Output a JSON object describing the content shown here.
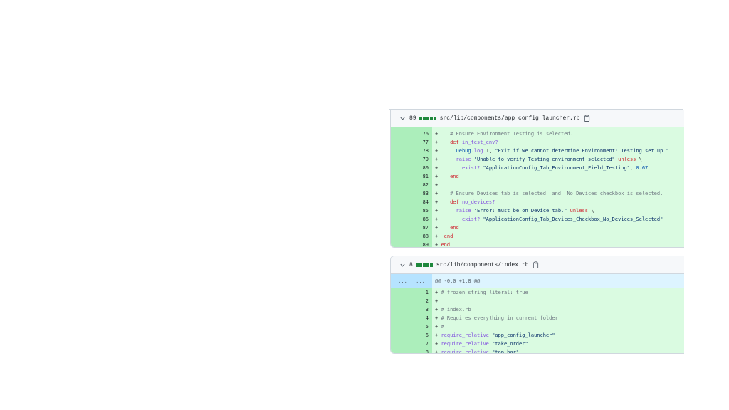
{
  "files": [
    {
      "count": "89",
      "path": "src/lib/components/app_config_launcher.rb",
      "lines": [
        {
          "num": "76",
          "tokens": [
            {
              "t": "+    ",
              "c": ""
            },
            {
              "t": "# Ensure Environment Testing is selected.",
              "c": "cm"
            }
          ]
        },
        {
          "num": "77",
          "tokens": [
            {
              "t": "+    ",
              "c": ""
            },
            {
              "t": "def ",
              "c": "kw"
            },
            {
              "t": "in_test_env?",
              "c": "fn"
            }
          ]
        },
        {
          "num": "78",
          "tokens": [
            {
              "t": "+      ",
              "c": ""
            },
            {
              "t": "Debug",
              "c": "nm"
            },
            {
              "t": ".",
              "c": ""
            },
            {
              "t": "log",
              "c": "fn"
            },
            {
              "t": " 1, ",
              "c": ""
            },
            {
              "t": "\"Exit if we cannot determine Environment: Testing set up.\"",
              "c": "st"
            }
          ]
        },
        {
          "num": "79",
          "tokens": [
            {
              "t": "+      ",
              "c": ""
            },
            {
              "t": "raise ",
              "c": "fn"
            },
            {
              "t": "\"Unable to verify Testing environment selected\"",
              "c": "st"
            },
            {
              "t": " unless ",
              "c": "kw"
            },
            {
              "t": "\\",
              "c": ""
            }
          ]
        },
        {
          "num": "80",
          "tokens": [
            {
              "t": "+        ",
              "c": ""
            },
            {
              "t": "exist?",
              "c": "fn"
            },
            {
              "t": " ",
              "c": ""
            },
            {
              "t": "\"ApplicationConfig_Tab_Environment_Field_Testing\"",
              "c": "st"
            },
            {
              "t": ", ",
              "c": ""
            },
            {
              "t": "0.67",
              "c": "nm"
            }
          ]
        },
        {
          "num": "81",
          "tokens": [
            {
              "t": "+    ",
              "c": ""
            },
            {
              "t": "end",
              "c": "kw"
            }
          ]
        },
        {
          "num": "82",
          "tokens": [
            {
              "t": "+",
              "c": ""
            }
          ]
        },
        {
          "num": "83",
          "tokens": [
            {
              "t": "+    ",
              "c": ""
            },
            {
              "t": "# Ensure Devices tab is selected _and_ No Devices checkbox is selected.",
              "c": "cm"
            }
          ]
        },
        {
          "num": "84",
          "tokens": [
            {
              "t": "+    ",
              "c": ""
            },
            {
              "t": "def ",
              "c": "kw"
            },
            {
              "t": "no_devices?",
              "c": "fn"
            }
          ]
        },
        {
          "num": "85",
          "tokens": [
            {
              "t": "+      ",
              "c": ""
            },
            {
              "t": "raise ",
              "c": "fn"
            },
            {
              "t": "\"Error: must be on Device tab.\"",
              "c": "st"
            },
            {
              "t": " unless ",
              "c": "kw"
            },
            {
              "t": "\\",
              "c": ""
            }
          ]
        },
        {
          "num": "86",
          "tokens": [
            {
              "t": "+        ",
              "c": ""
            },
            {
              "t": "exist?",
              "c": "fn"
            },
            {
              "t": " ",
              "c": ""
            },
            {
              "t": "\"ApplicationConfig_Tab_Devices_Checkbox_No_Devices_Selected\"",
              "c": "st"
            }
          ]
        },
        {
          "num": "87",
          "tokens": [
            {
              "t": "+    ",
              "c": ""
            },
            {
              "t": "end",
              "c": "kw"
            }
          ]
        },
        {
          "num": "88",
          "tokens": [
            {
              "t": "+  ",
              "c": ""
            },
            {
              "t": "end",
              "c": "kw"
            }
          ]
        },
        {
          "num": "89",
          "tokens": [
            {
              "t": "+ ",
              "c": ""
            },
            {
              "t": "end",
              "c": "kw"
            }
          ]
        }
      ]
    },
    {
      "count": "8",
      "path": "src/lib/components/index.rb",
      "hunk": {
        "left": "...",
        "right": "...",
        "text": "@@ -0,0 +1,8 @@"
      },
      "lines": [
        {
          "num": "1",
          "tokens": [
            {
              "t": "+ ",
              "c": ""
            },
            {
              "t": "# frozen_string_literal: true",
              "c": "cm"
            }
          ]
        },
        {
          "num": "2",
          "tokens": [
            {
              "t": "+",
              "c": ""
            }
          ]
        },
        {
          "num": "3",
          "tokens": [
            {
              "t": "+ ",
              "c": ""
            },
            {
              "t": "# index.rb",
              "c": "cm"
            }
          ]
        },
        {
          "num": "4",
          "tokens": [
            {
              "t": "+ ",
              "c": ""
            },
            {
              "t": "# Requires everything in current folder",
              "c": "cm"
            }
          ]
        },
        {
          "num": "5",
          "tokens": [
            {
              "t": "+ ",
              "c": ""
            },
            {
              "t": "#",
              "c": "cm"
            }
          ]
        },
        {
          "num": "6",
          "tokens": [
            {
              "t": "+ ",
              "c": ""
            },
            {
              "t": "require_relative",
              "c": "fn"
            },
            {
              "t": " ",
              "c": ""
            },
            {
              "t": "\"app_config_launcher\"",
              "c": "st"
            }
          ]
        },
        {
          "num": "7",
          "tokens": [
            {
              "t": "+ ",
              "c": ""
            },
            {
              "t": "require_relative",
              "c": "fn"
            },
            {
              "t": " ",
              "c": ""
            },
            {
              "t": "\"take_order\"",
              "c": "st"
            }
          ]
        },
        {
          "num": "8",
          "tokens": [
            {
              "t": "+ ",
              "c": ""
            },
            {
              "t": "require_relative",
              "c": "fn"
            },
            {
              "t": " ",
              "c": ""
            },
            {
              "t": "\"top_bar\"",
              "c": "st"
            }
          ]
        }
      ]
    }
  ],
  "icons": {
    "collapse": "chevron-down-icon",
    "copy": "clipboard-icon"
  },
  "colors": {
    "addition_bg": "#dafbe1",
    "addition_gutter": "#aceebb",
    "hunk_bg": "#ddf4ff",
    "hunk_gutter": "#b6e3ff",
    "diffstat": "#1f883d"
  }
}
